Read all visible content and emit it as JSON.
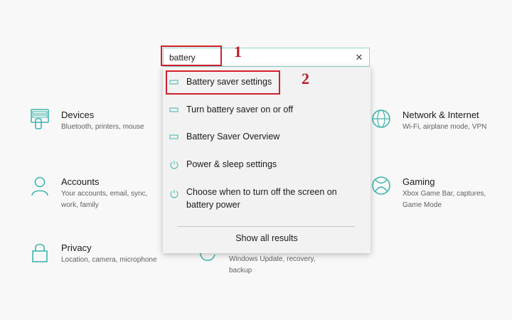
{
  "search": {
    "value": "battery",
    "clear_glyph": "✕"
  },
  "annotations": {
    "step1": "1",
    "step2": "2"
  },
  "results": [
    {
      "label": "Battery saver settings",
      "icon": "battery-icon"
    },
    {
      "label": "Turn battery saver on or off",
      "icon": "battery-icon"
    },
    {
      "label": "Battery Saver Overview",
      "icon": "battery-icon"
    },
    {
      "label": "Power & sleep settings",
      "icon": "power-icon"
    },
    {
      "label": "Choose when to turn off the screen on battery power",
      "icon": "power-icon"
    }
  ],
  "show_all_label": "Show all results",
  "tiles": {
    "devices": {
      "title": "Devices",
      "desc": "Bluetooth, printers, mouse",
      "icon": "devices-icon"
    },
    "accounts": {
      "title": "Accounts",
      "desc": "Your accounts, email, sync, work, family",
      "icon": "person-icon"
    },
    "privacy": {
      "title": "Privacy",
      "desc": "Location, camera, microphone",
      "icon": "lock-icon"
    },
    "network": {
      "title": "Network & Internet",
      "desc": "Wi-Fi, airplane mode, VPN",
      "icon": "globe-icon"
    },
    "gaming": {
      "title": "Gaming",
      "desc": "Xbox Game Bar, captures, Game Mode",
      "icon": "xbox-icon"
    },
    "update": {
      "desc": "Windows Update, recovery, backup",
      "icon": "update-icon"
    }
  },
  "colors": {
    "accent": "#3fb5ad",
    "annotation_red": "#d3202d",
    "background": "#f8f8f8",
    "dropdown_bg": "#f2f2f2"
  }
}
